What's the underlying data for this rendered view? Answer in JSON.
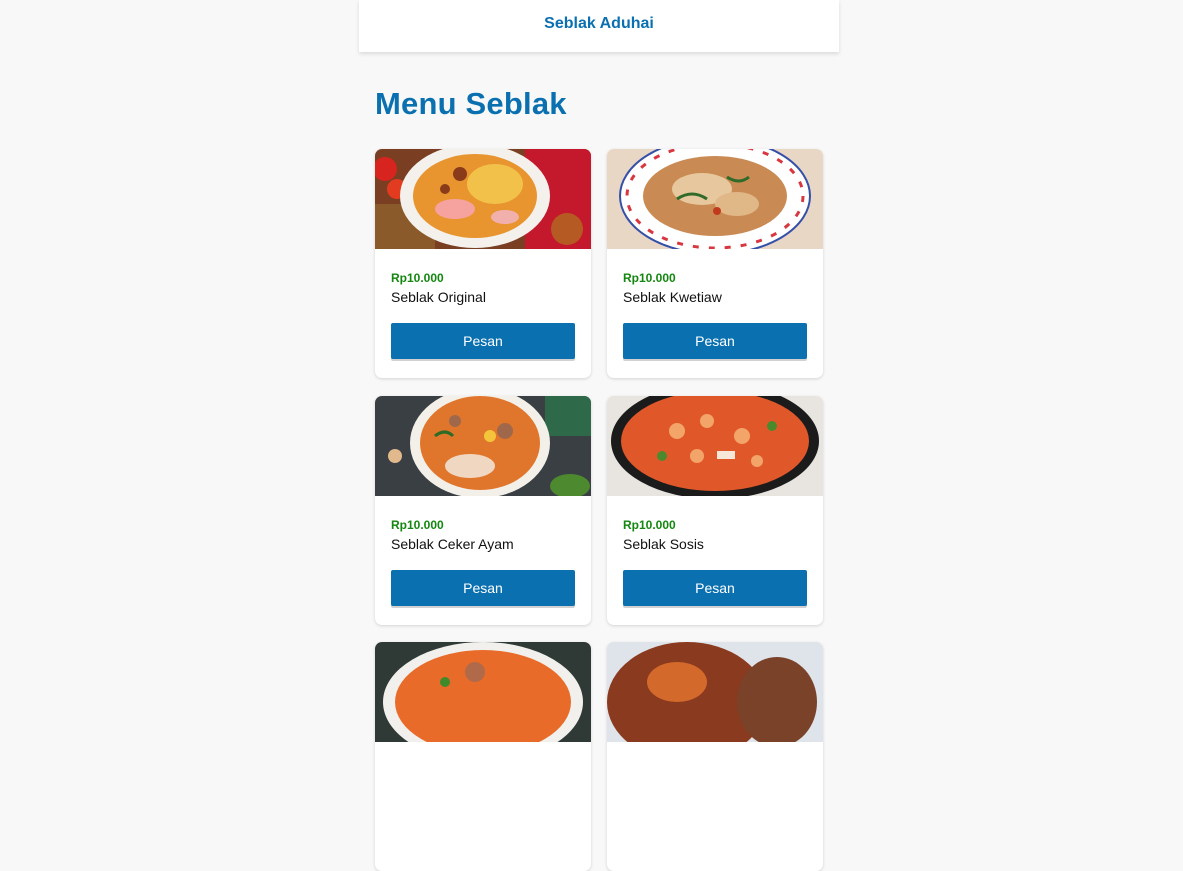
{
  "header": {
    "title": "Seblak Aduhai"
  },
  "page": {
    "title": "Menu Seblak"
  },
  "menu": [
    {
      "price": "Rp10.000",
      "name": "Seblak Original",
      "button": "Pesan"
    },
    {
      "price": "Rp10.000",
      "name": "Seblak Kwetiaw",
      "button": "Pesan"
    },
    {
      "price": "Rp10.000",
      "name": "Seblak Ceker Ayam",
      "button": "Pesan"
    },
    {
      "price": "Rp10.000",
      "name": "Seblak Sosis",
      "button": "Pesan"
    },
    {
      "price": "",
      "name": "",
      "button": ""
    },
    {
      "price": "",
      "name": "",
      "button": ""
    }
  ],
  "colors": {
    "accent": "#0b70b0",
    "price": "#13870f",
    "background": "#f8f8f8"
  }
}
